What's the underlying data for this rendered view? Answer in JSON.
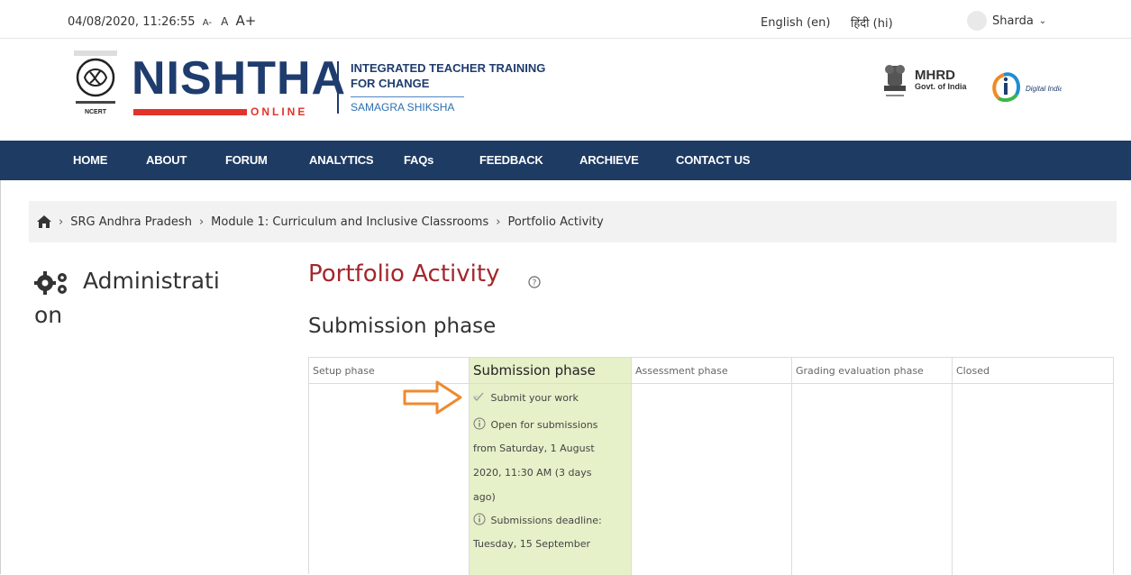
{
  "topbar": {
    "datetime": "04/08/2020, 11:26:55",
    "font_small": "A-",
    "font_normal": "A",
    "font_large": "A+",
    "lang_english": "English (en)",
    "lang_hindi": "हिंदी (hi)",
    "username": "Sharda",
    "chevron": "⌄"
  },
  "header": {
    "brand": "NISHTHA",
    "brand_sub": "ONLINE",
    "tagline_line1": "INTEGRATED TEACHER TRAINING",
    "tagline_line2": "FOR CHANGE",
    "tagline_sub": "SAMAGRA SHIKSHA",
    "mhrd": "MHRD",
    "mhrd_sub": "Govt. of India",
    "ncert": "NCERT",
    "digital_india": "Digital India"
  },
  "nav": {
    "items": [
      "HOME",
      "ABOUT",
      "FORUM",
      "ANALYTICS",
      "FAQs",
      "FEEDBACK",
      "ARCHIEVE",
      "CONTACT US"
    ]
  },
  "breadcrumb": {
    "items": [
      "SRG Andhra Pradesh",
      "Module 1: Curriculum and Inclusive Classrooms",
      "Portfolio Activity"
    ],
    "separator": "›"
  },
  "sidebar": {
    "admin_line1": "Administrati",
    "admin_line2": "on"
  },
  "main": {
    "title": "Portfolio Activity",
    "phase_heading": "Submission phase",
    "phases": [
      "Setup phase",
      "Submission phase",
      "Assessment phase",
      "Grading evaluation phase",
      "Closed"
    ],
    "task": "Submit your work",
    "info_lines_1": [
      "Open for submissions",
      "from Saturday, 1 August",
      "2020, 11:30 AM (3 days",
      "ago)"
    ],
    "info_lines_2": [
      "Submissions deadline:",
      "Tuesday, 15 September"
    ]
  },
  "colors": {
    "nav_bg": "#1e3b63",
    "title_red": "#a3272d",
    "active_phase_bg": "#e6f0c9",
    "arrow_orange": "#ed8a2f"
  }
}
